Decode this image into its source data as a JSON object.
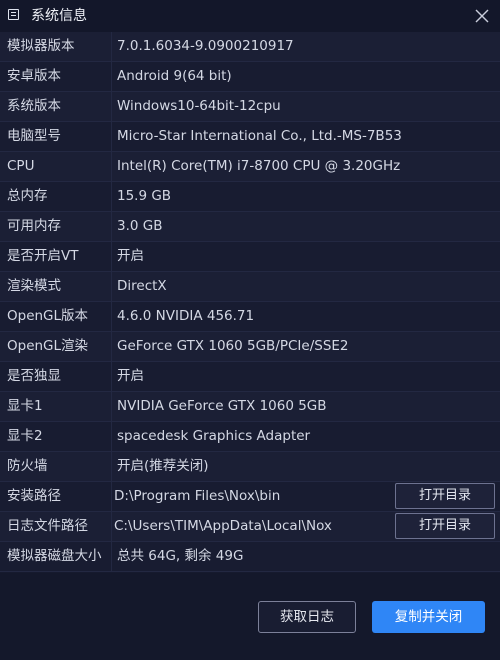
{
  "window": {
    "title": "系统信息",
    "close_icon": "close-icon"
  },
  "rows": [
    {
      "label": "模拟器版本",
      "value": "7.0.1.6034-9.0900210917"
    },
    {
      "label": "安卓版本",
      "value": "Android 9(64 bit)"
    },
    {
      "label": "系统版本",
      "value": "Windows10-64bit-12cpu"
    },
    {
      "label": "电脑型号",
      "value": "Micro-Star International Co., Ltd.-MS-7B53"
    },
    {
      "label": "CPU",
      "value": "Intel(R) Core(TM) i7-8700 CPU @ 3.20GHz"
    },
    {
      "label": "总内存",
      "value": "15.9 GB"
    },
    {
      "label": "可用内存",
      "value": "3.0 GB"
    },
    {
      "label": "是否开启VT",
      "value": "开启"
    },
    {
      "label": "渲染模式",
      "value": "DirectX"
    },
    {
      "label": "OpenGL版本",
      "value": "4.6.0 NVIDIA 456.71"
    },
    {
      "label": "OpenGL渲染",
      "value": "GeForce GTX 1060 5GB/PCIe/SSE2"
    },
    {
      "label": "是否独显",
      "value": "开启"
    },
    {
      "label": "显卡1",
      "value": "NVIDIA GeForce GTX 1060 5GB"
    },
    {
      "label": "显卡2",
      "value": "spacedesk Graphics Adapter"
    },
    {
      "label": "防火墙",
      "value": "开启(推荐关闭)"
    }
  ],
  "install_path": {
    "label": "安装路径",
    "value": "D:\\Program Files\\Nox\\bin",
    "button": "打开目录"
  },
  "log_path": {
    "label": "日志文件路径",
    "value": "C:\\Users\\TIM\\AppData\\Local\\Nox",
    "button": "打开目录"
  },
  "disk": {
    "label": "模拟器磁盘大小",
    "value": "总共 64G, 剩余 49G"
  },
  "footer": {
    "get_log": "获取日志",
    "copy_close": "复制并关闭"
  },
  "colors": {
    "background": "#161a2e",
    "row_alt": "#1b1f35",
    "accent": "#2f86f6",
    "text": "#d4d8e4"
  }
}
